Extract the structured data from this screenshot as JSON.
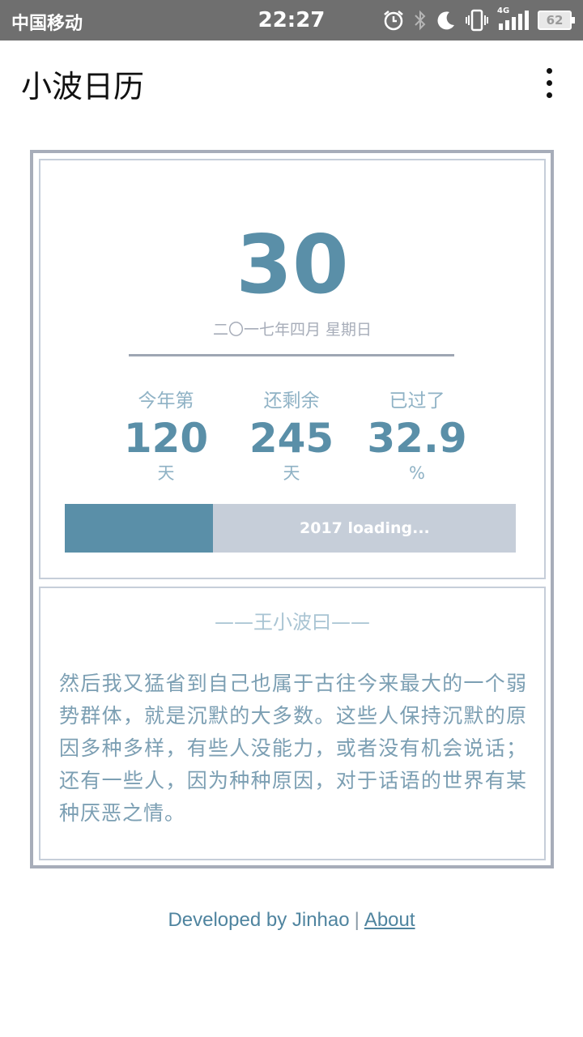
{
  "status_bar": {
    "carrier": "中国移动",
    "time": "22:27",
    "network": "4G",
    "battery": "62",
    "icons": [
      "alarm-icon",
      "bluetooth-icon",
      "moon-icon",
      "vibrate-icon",
      "signal-icon",
      "battery-icon"
    ]
  },
  "app": {
    "title": "小波日历",
    "menu_icon": "more-vert-icon"
  },
  "date_card": {
    "day": "30",
    "date_text": "二〇一七年四月 星期日",
    "stats": [
      {
        "label": "今年第",
        "value": "120",
        "unit": "天"
      },
      {
        "label": "还剩余",
        "value": "245",
        "unit": "天"
      },
      {
        "label": "已过了",
        "value": "32.9",
        "unit": "%"
      }
    ],
    "progress": {
      "fraction": 0.329,
      "text": "2017 loading..."
    }
  },
  "quote": {
    "title": "——王小波曰——",
    "text": "然后我又猛省到自己也属于古往今来最大的一个弱势群体，就是沉默的大多数。这些人保持沉默的原因多种多样，有些人没能力，或者没有机会说话；还有一些人，因为种种原因，对于话语的世界有某种厌恶之情。"
  },
  "footer": {
    "developed_by": "Developed by Jinhao",
    "separator": "|",
    "about_link": "About"
  },
  "colors": {
    "accent": "#5a8fa8",
    "status_bar": "#6f6f6f",
    "border": "#a7adb9",
    "progress_track": "#c6ced9"
  }
}
